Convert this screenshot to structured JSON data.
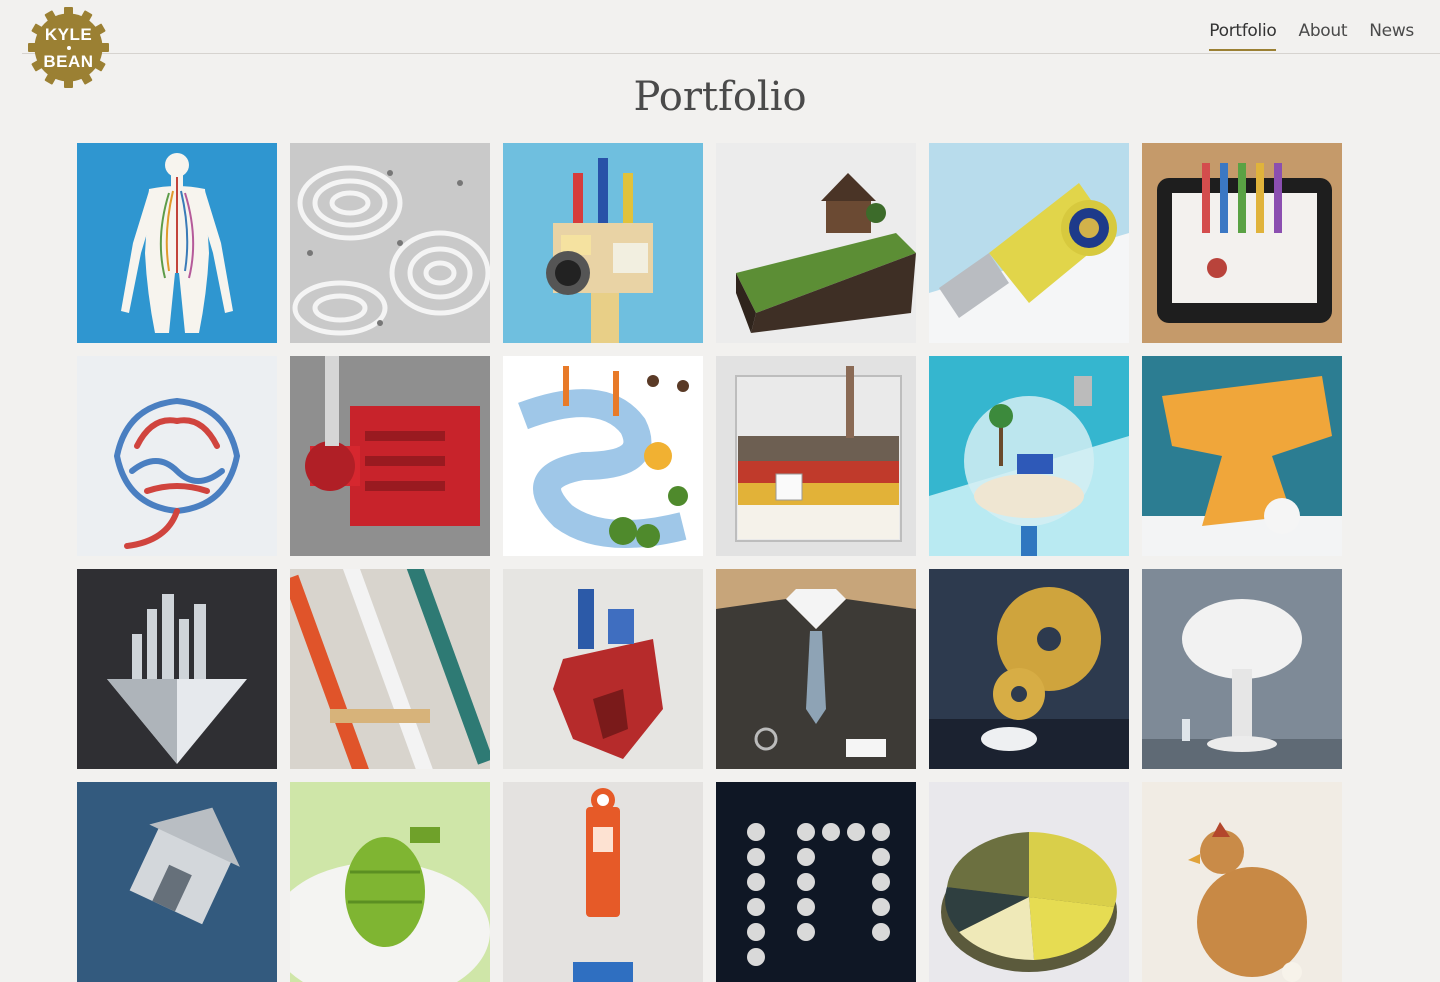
{
  "logo": {
    "line1": "KYLE",
    "line2": "BEAN",
    "color": "#9b8033"
  },
  "nav": [
    {
      "label": "Portfolio",
      "active": true
    },
    {
      "label": "About",
      "active": false
    },
    {
      "label": "News",
      "active": false
    }
  ],
  "page": {
    "title": "Portfolio"
  },
  "tiles": [
    {
      "icon": "paper-human-body-icon",
      "bg": "#2f96d0"
    },
    {
      "icon": "white-contour-landscape-icon",
      "bg": "#c9c9c9"
    },
    {
      "icon": "toy-factory-camera-icon",
      "bg": "#6fbfdf"
    },
    {
      "icon": "cake-slice-house-icon",
      "bg": "#ececec"
    },
    {
      "icon": "whistle-usb-drive-icon",
      "bg": "#b8dcec"
    },
    {
      "icon": "tablet-test-tubes-icon",
      "bg": "#c59a6a"
    },
    {
      "icon": "toothpaste-brain-icon",
      "bg": "#eceff2"
    },
    {
      "icon": "red-pipe-machine-icon",
      "bg": "#8f8f8f"
    },
    {
      "icon": "vegetable-river-icon",
      "bg": "#ffffff"
    },
    {
      "icon": "glass-tank-soil-icon",
      "bg": "#e2e2e2"
    },
    {
      "icon": "lightbulb-florida-icon",
      "bg": "#35b6cf"
    },
    {
      "icon": "sponge-anvil-icon",
      "bg": "#2c7d92"
    },
    {
      "icon": "diamond-city-icon",
      "bg": "#2f2f33"
    },
    {
      "icon": "striped-straws-icon",
      "bg": "#d8d4cd"
    },
    {
      "icon": "paper-heart-icon",
      "bg": "#e6e5e2"
    },
    {
      "icon": "suit-tie-icon",
      "bg": "#3d3a36"
    },
    {
      "icon": "golden-gears-mouse-icon",
      "bg": "#2d3a4e"
    },
    {
      "icon": "cotton-mushroom-cloud-icon",
      "bg": "#7e8a97"
    },
    {
      "icon": "tilted-house-icon",
      "bg": "#335a7e"
    },
    {
      "icon": "jelly-grenade-icon",
      "bg": "#cfe6a8"
    },
    {
      "icon": "fuel-pump-icon",
      "bg": "#e4e2e0"
    },
    {
      "icon": "pill-letters-icon",
      "bg": "#0f1725"
    },
    {
      "icon": "pie-chart-sculpture-icon",
      "bg": "#e9e8ec"
    },
    {
      "icon": "pastry-chicken-icon",
      "bg": "#f1ece4"
    }
  ]
}
